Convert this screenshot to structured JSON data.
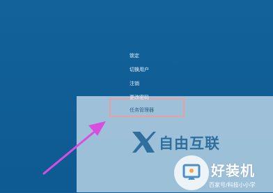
{
  "menu": {
    "items": [
      {
        "label": "锁定"
      },
      {
        "label": "切换用户"
      },
      {
        "label": "注销"
      },
      {
        "label": "更改密码"
      },
      {
        "label": "任务管理器"
      }
    ]
  },
  "watermark": {
    "text": "自由互联",
    "brand": "好装机",
    "source": "百家号/科技小小学"
  },
  "colors": {
    "background": "#0f5d95",
    "highlight": "#e9a0a3",
    "arrow": "#d84fe0"
  }
}
